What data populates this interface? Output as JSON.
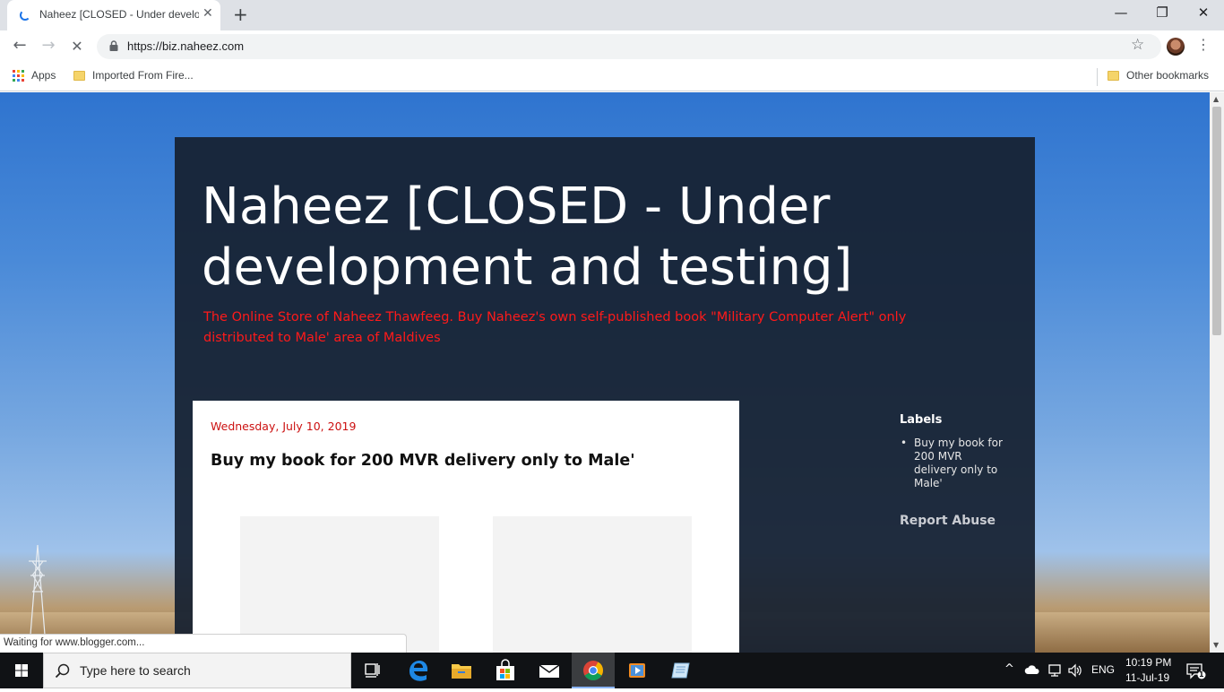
{
  "browser": {
    "tab_title": "Naheez [CLOSED - Under develop",
    "tab_close": "✕",
    "new_tab": "+",
    "win_minimize": "—",
    "win_restore": "❐",
    "win_close": "✕",
    "url": "https://biz.naheez.com",
    "back": "←",
    "forward": "→",
    "stop": "✕",
    "star": "☆",
    "menu": "⋮"
  },
  "bookmarks": {
    "apps": "Apps",
    "imported": "Imported From Fire...",
    "other": "Other bookmarks"
  },
  "blog": {
    "title": "Naheez [CLOSED - Under development and testing]",
    "description": "The Online Store of Naheez Thawfeeg. Buy Naheez's own self-published book \"Military Computer Alert\" only distributed to Male' area of Maldives",
    "post": {
      "date": "Wednesday, July 10, 2019",
      "title": "Buy my book for 200 MVR delivery only to Male'"
    },
    "sidebar": {
      "labels_heading": "Labels",
      "labels": [
        "Buy my book for 200 MVR delivery only to Male'"
      ],
      "report_abuse": "Report Abuse"
    }
  },
  "status_bar": "Waiting for www.blogger.com...",
  "taskbar": {
    "search_placeholder": "Type here to search",
    "lang": "ENG",
    "time": "10:19 PM",
    "date": "11-Jul-19",
    "notification_count": "1",
    "tray_chevron": "^"
  },
  "colors": {
    "blog_title": "#ffffff",
    "blog_description": "#ff1a1a",
    "post_date": "#cc1111",
    "chrome_accent": "#1a73e8"
  }
}
